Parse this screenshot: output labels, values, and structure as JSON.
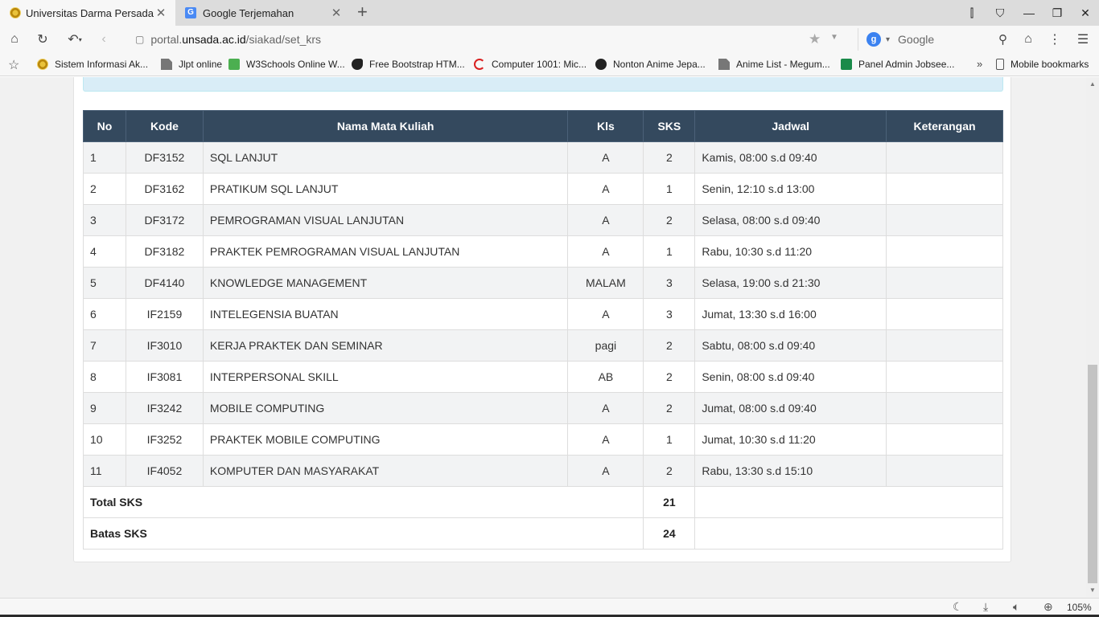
{
  "browser": {
    "tabs": [
      {
        "title": "Universitas Darma Persada - K",
        "active": true
      },
      {
        "title": "Google Terjemahan",
        "active": false
      }
    ],
    "url_prefix": "portal.",
    "url_host": "unsada.ac.id",
    "url_path": "/siakad/set_krs",
    "search_placeholder": "Google",
    "search_engine_badge": "g",
    "zoom": "105%"
  },
  "bookmarks": [
    {
      "label": "Sistem Informasi Ak...",
      "icon": "uni"
    },
    {
      "label": "Jlpt online",
      "icon": "doc"
    },
    {
      "label": "W3Schools Online W...",
      "icon": "w3"
    },
    {
      "label": "Free Bootstrap HTM...",
      "icon": "horse"
    },
    {
      "label": "Computer 1001: Mic...",
      "icon": "cred"
    },
    {
      "label": "Nonton Anime Jepa...",
      "icon": "k100"
    },
    {
      "label": "Anime List - Megum...",
      "icon": "doc"
    },
    {
      "label": "Panel Admin Jobsee...",
      "icon": "jobs"
    }
  ],
  "bookmarks_mobile": "Mobile bookmarks",
  "table": {
    "headers": [
      "No",
      "Kode",
      "Nama Mata Kuliah",
      "Kls",
      "SKS",
      "Jadwal",
      "Keterangan"
    ],
    "rows": [
      {
        "no": "1",
        "kode": "DF3152",
        "nama": "SQL LANJUT",
        "kls": "A",
        "sks": "2",
        "jadwal": "Kamis, 08:00 s.d 09:40",
        "ket": ""
      },
      {
        "no": "2",
        "kode": "DF3162",
        "nama": "PRATIKUM SQL LANJUT",
        "kls": "A",
        "sks": "1",
        "jadwal": "Senin, 12:10 s.d 13:00",
        "ket": ""
      },
      {
        "no": "3",
        "kode": "DF3172",
        "nama": "PEMROGRAMAN VISUAL LANJUTAN",
        "kls": "A",
        "sks": "2",
        "jadwal": "Selasa, 08:00 s.d 09:40",
        "ket": ""
      },
      {
        "no": "4",
        "kode": "DF3182",
        "nama": "PRAKTEK PEMROGRAMAN VISUAL LANJUTAN",
        "kls": "A",
        "sks": "1",
        "jadwal": "Rabu, 10:30 s.d 11:20",
        "ket": ""
      },
      {
        "no": "5",
        "kode": "DF4140",
        "nama": "KNOWLEDGE MANAGEMENT",
        "kls": "MALAM",
        "sks": "3",
        "jadwal": "Selasa, 19:00 s.d 21:30",
        "ket": ""
      },
      {
        "no": "6",
        "kode": "IF2159",
        "nama": "INTELEGENSIA BUATAN",
        "kls": "A",
        "sks": "3",
        "jadwal": "Jumat, 13:30 s.d 16:00",
        "ket": ""
      },
      {
        "no": "7",
        "kode": "IF3010",
        "nama": "KERJA PRAKTEK DAN SEMINAR",
        "kls": "pagi",
        "sks": "2",
        "jadwal": "Sabtu, 08:00 s.d 09:40",
        "ket": ""
      },
      {
        "no": "8",
        "kode": "IF3081",
        "nama": "INTERPERSONAL SKILL",
        "kls": "AB",
        "sks": "2",
        "jadwal": "Senin, 08:00 s.d 09:40",
        "ket": ""
      },
      {
        "no": "9",
        "kode": "IF3242",
        "nama": "MOBILE COMPUTING",
        "kls": "A",
        "sks": "2",
        "jadwal": "Jumat, 08:00 s.d 09:40",
        "ket": ""
      },
      {
        "no": "10",
        "kode": "IF3252",
        "nama": "PRAKTEK MOBILE COMPUTING",
        "kls": "A",
        "sks": "1",
        "jadwal": "Jumat, 10:30 s.d 11:20",
        "ket": ""
      },
      {
        "no": "11",
        "kode": "IF4052",
        "nama": "KOMPUTER DAN MASYARAKAT",
        "kls": "A",
        "sks": "2",
        "jadwal": "Rabu, 13:30 s.d 15:10",
        "ket": ""
      }
    ],
    "total_label": "Total SKS",
    "total_value": "21",
    "batas_label": "Batas SKS",
    "batas_value": "24"
  }
}
